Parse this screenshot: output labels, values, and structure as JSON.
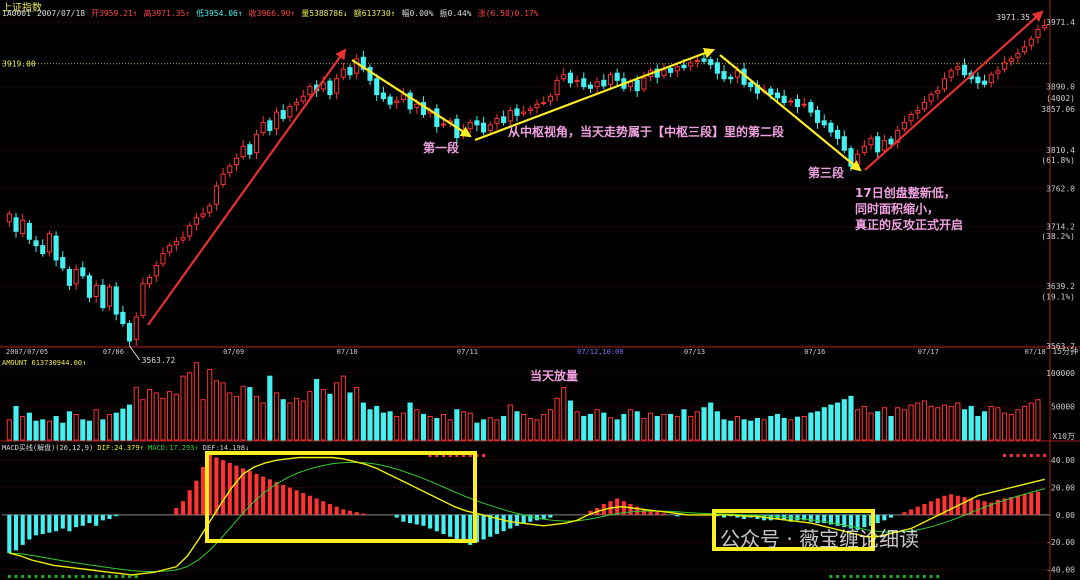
{
  "header": {
    "title": "上证指数",
    "code": "1A0001",
    "date": "2007/07/18",
    "open": "开3959.21↑",
    "high": "高3971.35↑",
    "low": "低3954.06↑",
    "close": "收3966.90↑",
    "volume": "量5388786↓",
    "amount": "额613730↑",
    "change_pct": "幅0.00%",
    "turnover": "振0.44%",
    "rise": "涨(6.58)0.17%"
  },
  "price_panel": {
    "left_price_label": "3919.00",
    "high_label": "3971.35",
    "low_label": "3563.72",
    "right_axis": [
      "3971.4",
      "3890.0",
      "(4002)",
      "3857.06",
      "3810.4",
      "(61.8%)",
      "3762.0",
      "3714.2",
      "(38.2%)",
      "3639.2",
      "(19.1%)",
      "3563.7"
    ],
    "date_ticks": [
      "2007/07/05",
      "07/06",
      "07/09",
      "07/10",
      "07/11",
      "07/12,10:00",
      "07/13",
      "07/16",
      "07/17",
      "07/18"
    ],
    "period": "15分钟"
  },
  "volume_panel": {
    "label": "AMOUNT 613730944.00↑",
    "axis": [
      "100000",
      "50000",
      "X10万"
    ]
  },
  "macd_panel": {
    "label": "MACD买线(解盘)(26,12,9)",
    "dif": "DIF:24.379↑",
    "macd": "MACD:17.293↑",
    "dea": "DEF:14.198↓",
    "axis": [
      "40.00",
      "20.00",
      "0.00",
      "-20.00",
      "-40.00"
    ]
  },
  "annotations": {
    "seg1": "第一段",
    "seg2": "从中枢视角，当天走势属于【中枢三段】里的第二段",
    "seg3": "第三段",
    "note17": "17日创盘整新低，\n同时面积缩小，\n真正的反攻正式开启",
    "vol_note": "当天放量"
  },
  "watermark": "公众号 · 薇宝缠论细读",
  "colors": {
    "up": "#ff3333",
    "down": "#44f0f0",
    "annotation_text": "#f0a0e0",
    "yellow": "#ffee22",
    "red_arrow": "#e83030",
    "dea_line": "#33cc33"
  },
  "chart_data": [
    {
      "type": "candlestick",
      "title": "上证指数 15分钟",
      "ylim": [
        3563.7,
        3971.4
      ],
      "close": [
        3730,
        3708,
        3722,
        3698,
        3690,
        3680,
        3705,
        3672,
        3662,
        3640,
        3660,
        3652,
        3625,
        3640,
        3612,
        3638,
        3604,
        3592,
        3570,
        3600,
        3642,
        3650,
        3665,
        3680,
        3690,
        3695,
        3700,
        3715,
        3725,
        3730,
        3740,
        3765,
        3780,
        3790,
        3800,
        3815,
        3805,
        3830,
        3845,
        3835,
        3858,
        3850,
        3865,
        3870,
        3878,
        3890,
        3885,
        3895,
        3880,
        3900,
        3912,
        3905,
        3925,
        3912,
        3898,
        3880,
        3875,
        3868,
        3872,
        3880,
        3862,
        3868,
        3855,
        3860,
        3840,
        3843,
        3847,
        3826,
        3835,
        3845,
        3842,
        3833,
        3842,
        3850,
        3845,
        3860,
        3854,
        3858,
        3862,
        3868,
        3870,
        3878,
        3898,
        3905,
        3895,
        3898,
        3890,
        3888,
        3896,
        3891,
        3905,
        3898,
        3888,
        3896,
        3885,
        3901,
        3910,
        3902,
        3911,
        3908,
        3915,
        3914,
        3920,
        3923,
        3922,
        3918,
        3907,
        3900,
        3900,
        3910,
        3893,
        3890,
        3882,
        3885,
        3880,
        3876,
        3870,
        3872,
        3865,
        3868,
        3858,
        3845,
        3842,
        3833,
        3825,
        3810,
        3790,
        3805,
        3815,
        3825,
        3808,
        3822,
        3818,
        3835,
        3845,
        3855,
        3860,
        3870,
        3880,
        3885,
        3900,
        3910,
        3915,
        3905,
        3900,
        3895,
        3893,
        3905,
        3910,
        3920,
        3925,
        3932,
        3940,
        3950,
        3962,
        3967
      ],
      "open": [
        3720,
        3725,
        3705,
        3718,
        3696,
        3690,
        3682,
        3702,
        3675,
        3660,
        3642,
        3662,
        3652,
        3626,
        3640,
        3614,
        3638,
        3606,
        3592,
        3572,
        3602,
        3642,
        3652,
        3667,
        3682,
        3691,
        3697,
        3702,
        3717,
        3727,
        3732,
        3742,
        3767,
        3782,
        3792,
        3802,
        3817,
        3807,
        3832,
        3847,
        3837,
        3860,
        3852,
        3867,
        3872,
        3880,
        3892,
        3887,
        3897,
        3882,
        3902,
        3914,
        3907,
        3927,
        3914,
        3900,
        3882,
        3877,
        3870,
        3874,
        3882,
        3864,
        3870,
        3857,
        3862,
        3842,
        3845,
        3849,
        3828,
        3837,
        3847,
        3844,
        3835,
        3844,
        3852,
        3847,
        3862,
        3856,
        3860,
        3864,
        3870,
        3872,
        3880,
        3900,
        3907,
        3897,
        3900,
        3892,
        3890,
        3898,
        3893,
        3907,
        3900,
        3890,
        3898,
        3887,
        3903,
        3912,
        3904,
        3913,
        3910,
        3917,
        3916,
        3922,
        3925,
        3924,
        3920,
        3909,
        3902,
        3902,
        3912,
        3895,
        3892,
        3884,
        3887,
        3882,
        3878,
        3872,
        3874,
        3867,
        3870,
        3860,
        3847,
        3844,
        3835,
        3827,
        3812,
        3792,
        3807,
        3817,
        3827,
        3810,
        3824,
        3820,
        3837,
        3847,
        3857,
        3862,
        3872,
        3882,
        3887,
        3902,
        3912,
        3917,
        3907,
        3902,
        3897,
        3895,
        3907,
        3912,
        3922,
        3927,
        3934,
        3942,
        3952,
        3964
      ]
    },
    {
      "type": "bar",
      "title": "AMOUNT",
      "ylabel": "X10万",
      "ylim": [
        0,
        125000
      ],
      "values": [
        30000,
        50000,
        35000,
        40000,
        28000,
        30000,
        28000,
        35000,
        25000,
        42000,
        38000,
        30000,
        28000,
        45000,
        30000,
        38000,
        40000,
        46000,
        52000,
        78000,
        60000,
        75000,
        70000,
        62000,
        72000,
        68000,
        95000,
        100000,
        115000,
        60000,
        105000,
        88000,
        85000,
        70000,
        65000,
        80000,
        78000,
        65000,
        55000,
        95000,
        70000,
        60000,
        55000,
        62000,
        58000,
        72000,
        90000,
        75000,
        68000,
        85000,
        95000,
        70000,
        78000,
        55000,
        45000,
        50000,
        40000,
        42000,
        35000,
        40000,
        55000,
        45000,
        38000,
        35000,
        32000,
        38000,
        30000,
        45000,
        42000,
        40000,
        25000,
        30000,
        33000,
        30000,
        35000,
        52000,
        42000,
        38000,
        32000,
        30000,
        38000,
        45000,
        62000,
        78000,
        58000,
        42000,
        35000,
        38000,
        45000,
        40000,
        33000,
        30000,
        38000,
        45000,
        42000,
        32000,
        40000,
        35000,
        38000,
        38000,
        35000,
        45000,
        35000,
        42000,
        48000,
        55000,
        42000,
        30000,
        28000,
        35000,
        30000,
        28000,
        32000,
        30000,
        35000,
        38000,
        32000,
        30000,
        34000,
        35000,
        40000,
        42000,
        48000,
        52000,
        55000,
        60000,
        65000,
        45000,
        50000,
        40000,
        42000,
        48000,
        35000,
        48000,
        45000,
        52000,
        55000,
        58000,
        50000,
        48000,
        52000,
        50000,
        55000,
        45000,
        50000,
        35000,
        42000,
        50000,
        48000,
        40000,
        38000,
        45000,
        50000,
        55000,
        60000
      ]
    },
    {
      "type": "bar",
      "title": "MACD",
      "ylim": [
        -44,
        46
      ],
      "values": [
        -28,
        -26,
        -22,
        -18,
        -15,
        -14,
        -13,
        -12,
        -10,
        -12,
        -9,
        -8,
        -6,
        -8,
        -4,
        -3,
        -1,
        0,
        0,
        0,
        0,
        0,
        0,
        0,
        0,
        5,
        10,
        18,
        25,
        35,
        45,
        42,
        40,
        38,
        36,
        34,
        32,
        30,
        28,
        26,
        24,
        22,
        20,
        18,
        16,
        14,
        12,
        10,
        8,
        6,
        4,
        3,
        2,
        1,
        0,
        0,
        0,
        0,
        -2,
        -5,
        -6,
        -7,
        -8,
        -10,
        -12,
        -14,
        -16,
        -18,
        -20,
        -22,
        -20,
        -18,
        -16,
        -14,
        -12,
        -10,
        -8,
        -6,
        -5,
        -4,
        -3,
        -2,
        0,
        0,
        0,
        0,
        0,
        3,
        5,
        8,
        10,
        12,
        10,
        8,
        6,
        4,
        3,
        2,
        1,
        0,
        -1,
        0,
        0,
        0,
        0,
        0,
        -1,
        -2,
        -1,
        -2,
        -3,
        -2,
        -3,
        -4,
        -4,
        -3,
        -4,
        -5,
        -4,
        -4,
        -5,
        -6,
        -6,
        -7,
        -8,
        -9,
        -10,
        -11,
        -9,
        -8,
        -6,
        -4,
        -2,
        0,
        2,
        4,
        6,
        8,
        10,
        12,
        14,
        15,
        14,
        13,
        12,
        11,
        10,
        9,
        11,
        12,
        13,
        14,
        15,
        16,
        17
      ],
      "dif": [
        -28,
        -30,
        -33,
        -35,
        -37,
        -38,
        -39,
        -40,
        -41,
        -42,
        -43,
        -44,
        -43,
        -42,
        -40,
        -38,
        -30,
        -18,
        -5,
        8,
        20,
        30,
        35,
        38,
        40,
        41,
        42,
        42,
        42,
        42,
        41,
        39,
        37,
        34,
        30,
        26,
        22,
        18,
        14,
        10,
        6,
        3,
        1,
        -1,
        -3,
        -5,
        -6,
        -7,
        -8,
        -7,
        -6,
        -4,
        0,
        3,
        5,
        6,
        5,
        4,
        3,
        2,
        1,
        0,
        0,
        0,
        0,
        0,
        -1,
        -1,
        -2,
        -3,
        -4,
        -5,
        -6,
        -8,
        -10,
        -12,
        -14,
        -16,
        -16,
        -14,
        -12,
        -10,
        -6,
        -2,
        2,
        6,
        10,
        14,
        16,
        18,
        20,
        22,
        24,
        26
      ]
    }
  ]
}
